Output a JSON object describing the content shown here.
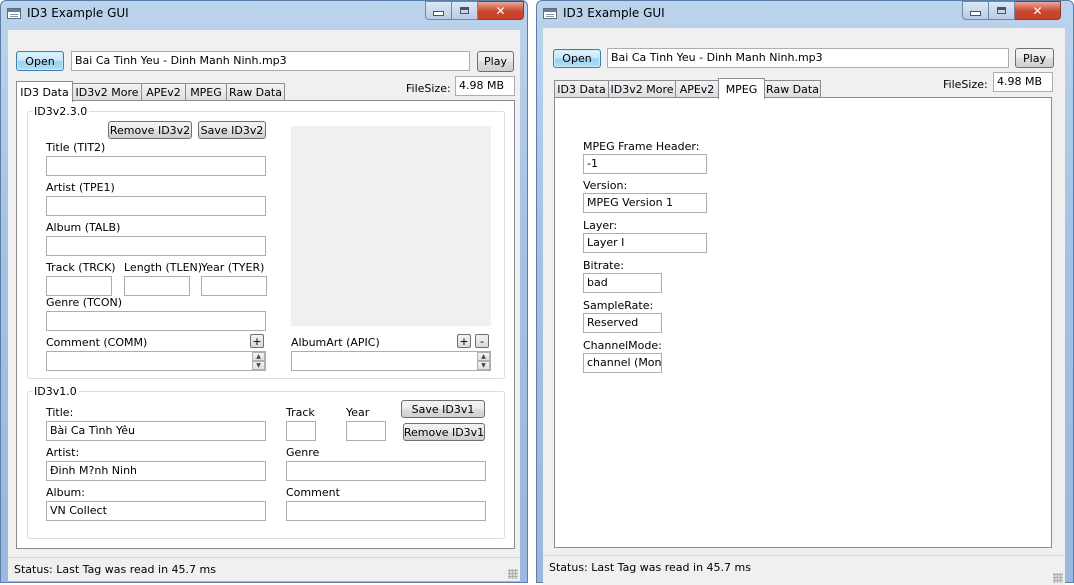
{
  "left_window": {
    "title": "ID3 Example GUI",
    "open_label": "Open",
    "file_path": "Bai Ca Tinh Yeu - Dinh Manh Ninh.mp3",
    "play_label": "Play",
    "tabs": [
      {
        "label": "ID3 Data",
        "active": true
      },
      {
        "label": "ID3v2 More",
        "active": false
      },
      {
        "label": "APEv2",
        "active": false
      },
      {
        "label": "MPEG",
        "active": false
      },
      {
        "label": "Raw Data",
        "active": false
      }
    ],
    "filesize_label": "FileSize:",
    "filesize_value": "4.98 MB",
    "id3v2": {
      "group_title": "ID3v2.3.0",
      "remove_label": "Remove ID3v2",
      "save_label": "Save ID3v2",
      "title_label": "Title (TIT2)",
      "title_value": "",
      "artist_label": "Artist (TPE1)",
      "artist_value": "",
      "album_label": "Album (TALB)",
      "album_value": "",
      "track_label": "Track (TRCK)",
      "track_value": "",
      "length_label": "Length (TLEN)",
      "length_value": "",
      "year_label": "Year (TYER)",
      "year_value": "",
      "genre_label": "Genre (TCON)",
      "genre_value": "",
      "comment_label": "Comment (COMM)",
      "comment_value": "",
      "comment_add": "+",
      "albumart_label": "AlbumArt (APIC)",
      "albumart_add": "+",
      "albumart_remove": "-",
      "albumart_value": ""
    },
    "id3v1": {
      "group_title": "ID3v1.0",
      "title_label": "Title:",
      "title_value": "Bài Ca Tình Yêu",
      "track_label": "Track",
      "track_value": "",
      "year_label": "Year",
      "year_value": "",
      "save_label": "Save ID3v1",
      "remove_label": "Remove ID3v1",
      "artist_label": "Artist:",
      "artist_value": "Đinh M?nh Ninh",
      "genre_label": "Genre",
      "genre_value": "",
      "album_label": "Album:",
      "album_value": "VN Collect",
      "comment_label": "Comment",
      "comment_value": ""
    },
    "status": "Status: Last Tag was read in 45.7 ms"
  },
  "right_window": {
    "title": "ID3 Example GUI",
    "open_label": "Open",
    "file_path": "Bai Ca Tinh Yeu - Dinh Manh Ninh.mp3",
    "play_label": "Play",
    "tabs": [
      {
        "label": "ID3 Data",
        "active": false
      },
      {
        "label": "ID3v2 More",
        "active": false
      },
      {
        "label": "APEv2",
        "active": false
      },
      {
        "label": "MPEG",
        "active": true
      },
      {
        "label": "Raw Data",
        "active": false
      }
    ],
    "filesize_label": "FileSize:",
    "filesize_value": "4.98 MB",
    "mpeg": {
      "frame_header_label": "MPEG Frame Header:",
      "frame_header_value": "-1",
      "version_label": "Version:",
      "version_value": "MPEG Version 1",
      "layer_label": "Layer:",
      "layer_value": "Layer I",
      "bitrate_label": "Bitrate:",
      "bitrate_value": "bad",
      "samplerate_label": "SampleRate:",
      "samplerate_value": "Reserved",
      "channelmode_label": "ChannelMode:",
      "channelmode_value": "channel (Mono)"
    },
    "status": "Status: Last Tag was read in 45.7 ms"
  },
  "colors": {
    "frame": "#a6c2e3",
    "client": "#f0f0f0",
    "accent_button": "#98d1ef",
    "close_button": "#c9462d"
  }
}
